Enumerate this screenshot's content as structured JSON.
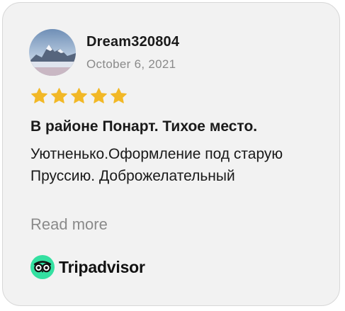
{
  "review": {
    "username": "Dream320804",
    "date": "October 6, 2021",
    "rating": 5,
    "max_rating": 5,
    "title": "В районе Понарт. Тихое место.",
    "body": "Уютненько.Оформление под старую Пруссию. Доброжелательный",
    "read_more": "Read more"
  },
  "brand": {
    "name": "Tripadvisor",
    "icon": "tripadvisor-owl-icon"
  },
  "colors": {
    "card_background": "#f2f2f2",
    "star": "#f2b827",
    "brand_green": "#34e0a1",
    "muted_text": "#8a8a8a"
  }
}
